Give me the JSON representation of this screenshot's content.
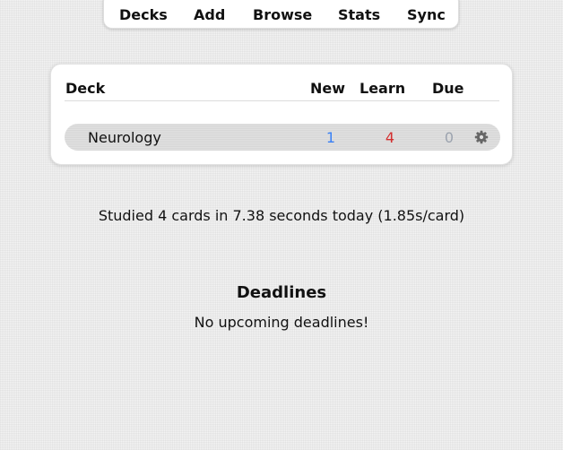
{
  "toolbar": {
    "items": [
      "Decks",
      "Add",
      "Browse",
      "Stats",
      "Sync"
    ]
  },
  "deck_table": {
    "headers": {
      "deck": "Deck",
      "new": "New",
      "learn": "Learn",
      "due": "Due"
    },
    "rows": [
      {
        "name": "Neurology",
        "new": "1",
        "learn": "4",
        "due": "0",
        "options_icon": "gear-icon"
      }
    ]
  },
  "colors": {
    "new": "#3b82f6",
    "learn": "#d32f2f",
    "due": "#9ca3af"
  },
  "studied_text": "Studied 4 cards in 7.38 seconds today (1.85s/card)",
  "deadlines": {
    "title": "Deadlines",
    "message": "No upcoming deadlines!"
  }
}
